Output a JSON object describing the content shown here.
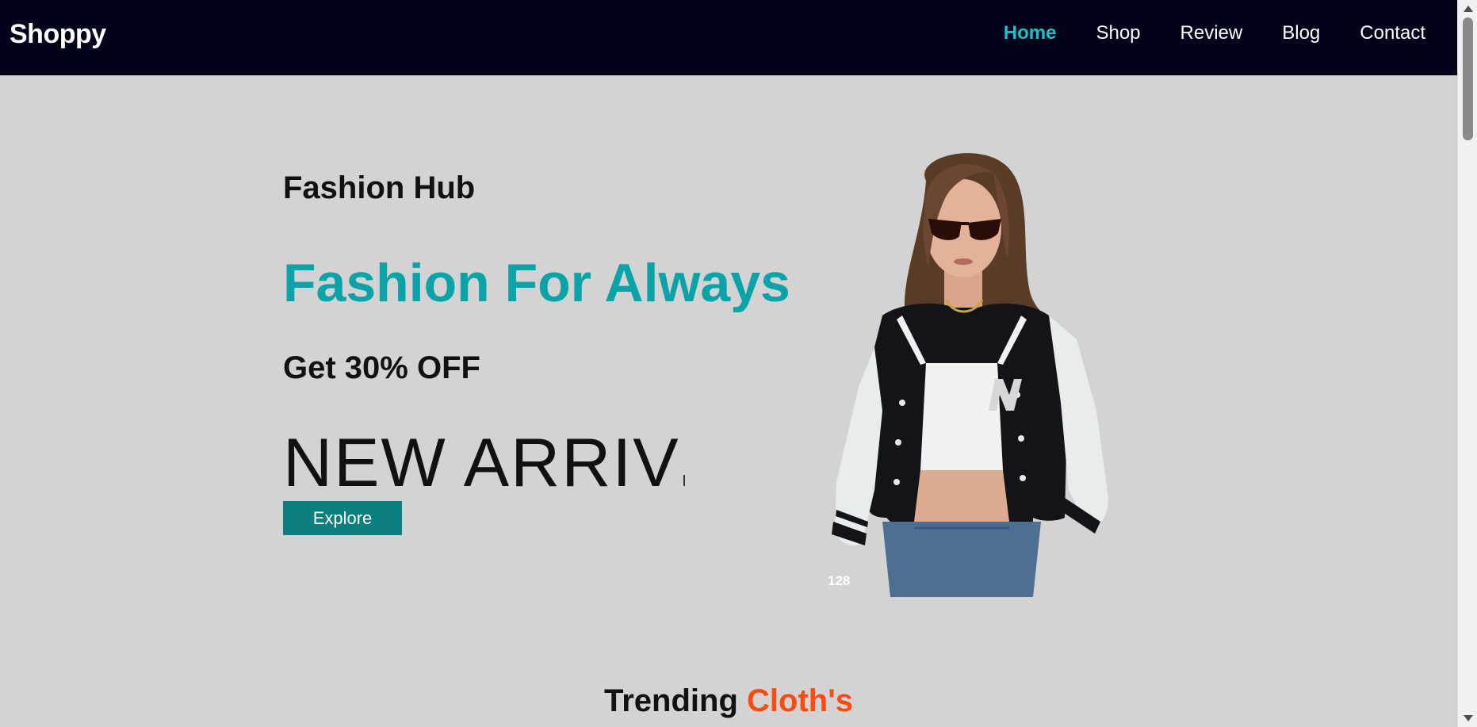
{
  "navbar": {
    "brand": "Shoppy",
    "links": [
      {
        "label": "Home",
        "active": true
      },
      {
        "label": "Shop",
        "active": false
      },
      {
        "label": "Review",
        "active": false
      },
      {
        "label": "Blog",
        "active": false
      },
      {
        "label": "Contact",
        "active": false
      }
    ]
  },
  "hero": {
    "kicker": "Fashion Hub",
    "title": "Fashion For Always",
    "offer": "Get 30% OFF",
    "typed_text": "NEW ARRIV",
    "explore_label": "Explore",
    "image_badge": "128"
  },
  "trending": {
    "heading_main": "Trending ",
    "heading_accent": "Cloth's"
  },
  "colors": {
    "navbar_bg": "#01011a",
    "active_link": "#19c2c9",
    "title_teal": "#0aa3a8",
    "button_teal": "#0d7f7f",
    "accent_orange": "#ff4a10",
    "page_bg": "#d3d3d3"
  },
  "icons": {
    "scroll_up": "chevron-up-icon",
    "scroll_down": "chevron-down-icon"
  }
}
